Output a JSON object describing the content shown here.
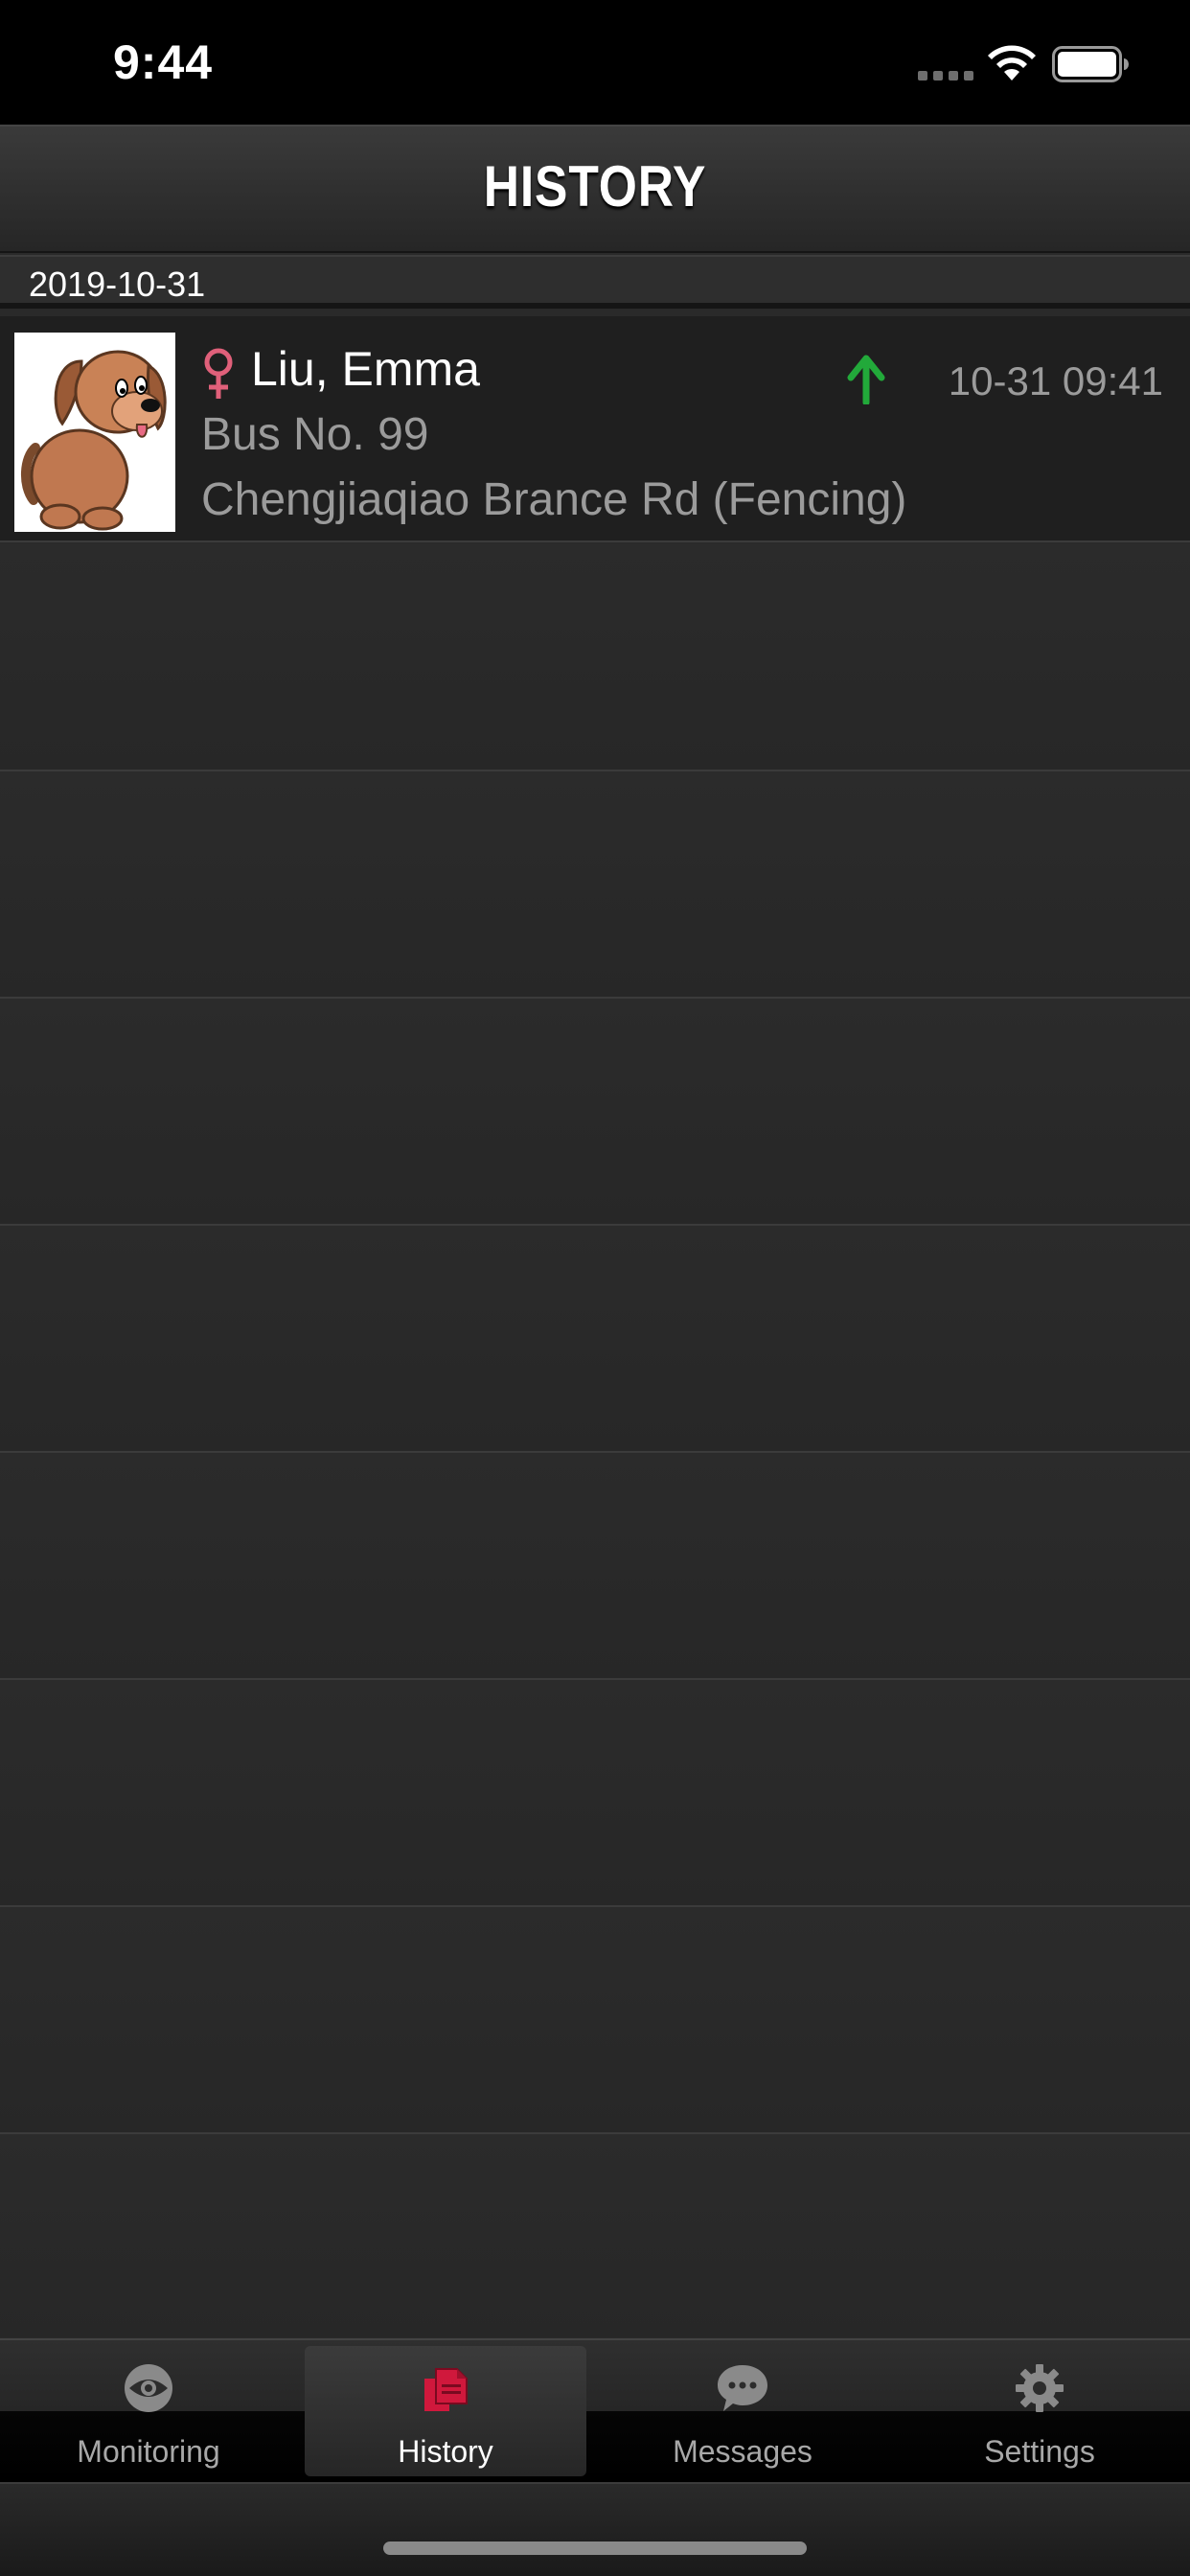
{
  "status_bar": {
    "time": "9:44"
  },
  "nav": {
    "title": "HISTORY"
  },
  "section": {
    "date": "2019-10-31"
  },
  "history": [
    {
      "name": "Liu, Emma",
      "bus": "Bus No. 99",
      "stop": "Chengjiaqiao Brance Rd (Fencing)",
      "time": "10-31 09:41",
      "gender_icon": "female-icon",
      "direction_icon": "arrow-up-icon",
      "direction_color": "#22a93a",
      "gender_color": "#e0607a"
    }
  ],
  "tabs": [
    {
      "label": "Monitoring",
      "icon": "eye-icon",
      "active": false
    },
    {
      "label": "History",
      "icon": "documents-icon",
      "active": true
    },
    {
      "label": "Messages",
      "icon": "chat-bubble-icon",
      "active": false
    },
    {
      "label": "Settings",
      "icon": "gear-icon",
      "active": false
    }
  ],
  "colors": {
    "accent": "#d0183c",
    "background": "#2a2a2a"
  }
}
